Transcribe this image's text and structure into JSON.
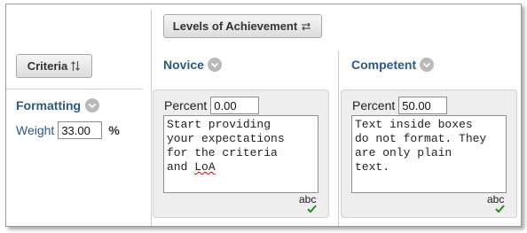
{
  "toolbar": {
    "levels_button_label": "Levels of Achievement",
    "criteria_button_label": "Criteria"
  },
  "columns": [
    {
      "name": "Novice"
    },
    {
      "name": "Competent"
    }
  ],
  "criterion": {
    "name": "Formatting",
    "weight_label": "Weight",
    "weight_value": "33.00",
    "weight_unit": "%"
  },
  "cells": [
    {
      "percent_label": "Percent",
      "percent_value": "0.00",
      "text_lines": [
        "Start providing",
        "your expectations",
        "for the criteria",
        "and "
      ],
      "misspelled_word": "LoA",
      "spellcheck_label": "abc"
    },
    {
      "percent_label": "Percent",
      "percent_value": "50.00",
      "text_lines": [
        "Text inside boxes",
        "do not format. They",
        "are only plain",
        "text."
      ],
      "spellcheck_label": "abc"
    }
  ],
  "colors": {
    "header_text": "#2b5b84",
    "cell_bg": "#eeeeee",
    "icon_circle": "#b9b9b9"
  }
}
